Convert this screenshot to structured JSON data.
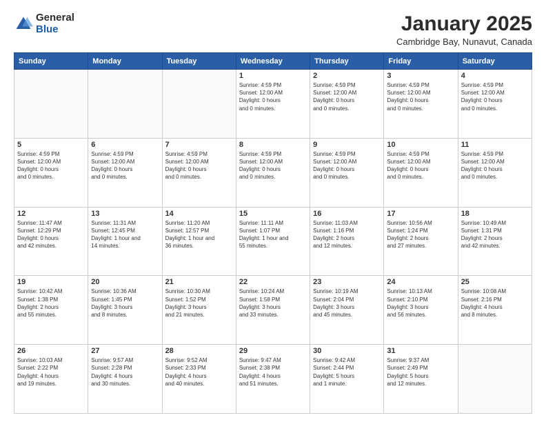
{
  "header": {
    "logo_general": "General",
    "logo_blue": "Blue",
    "main_title": "January 2025",
    "subtitle": "Cambridge Bay, Nunavut, Canada"
  },
  "weekdays": [
    "Sunday",
    "Monday",
    "Tuesday",
    "Wednesday",
    "Thursday",
    "Friday",
    "Saturday"
  ],
  "weeks": [
    [
      {
        "day": "",
        "info": ""
      },
      {
        "day": "",
        "info": ""
      },
      {
        "day": "",
        "info": ""
      },
      {
        "day": "1",
        "info": "Sunrise: 4:59 PM\nSunset: 12:00 AM\nDaylight: 0 hours\nand 0 minutes."
      },
      {
        "day": "2",
        "info": "Sunrise: 4:59 PM\nSunset: 12:00 AM\nDaylight: 0 hours\nand 0 minutes."
      },
      {
        "day": "3",
        "info": "Sunrise: 4:59 PM\nSunset: 12:00 AM\nDaylight: 0 hours\nand 0 minutes."
      },
      {
        "day": "4",
        "info": "Sunrise: 4:59 PM\nSunset: 12:00 AM\nDaylight: 0 hours\nand 0 minutes."
      }
    ],
    [
      {
        "day": "5",
        "info": "Sunrise: 4:59 PM\nSunset: 12:00 AM\nDaylight: 0 hours\nand 0 minutes."
      },
      {
        "day": "6",
        "info": "Sunrise: 4:59 PM\nSunset: 12:00 AM\nDaylight: 0 hours\nand 0 minutes."
      },
      {
        "day": "7",
        "info": "Sunrise: 4:59 PM\nSunset: 12:00 AM\nDaylight: 0 hours\nand 0 minutes."
      },
      {
        "day": "8",
        "info": "Sunrise: 4:59 PM\nSunset: 12:00 AM\nDaylight: 0 hours\nand 0 minutes."
      },
      {
        "day": "9",
        "info": "Sunrise: 4:59 PM\nSunset: 12:00 AM\nDaylight: 0 hours\nand 0 minutes."
      },
      {
        "day": "10",
        "info": "Sunrise: 4:59 PM\nSunset: 12:00 AM\nDaylight: 0 hours\nand 0 minutes."
      },
      {
        "day": "11",
        "info": "Sunrise: 4:59 PM\nSunset: 12:00 AM\nDaylight: 0 hours\nand 0 minutes."
      }
    ],
    [
      {
        "day": "12",
        "info": "Sunrise: 11:47 AM\nSunset: 12:29 PM\nDaylight: 0 hours\nand 42 minutes."
      },
      {
        "day": "13",
        "info": "Sunrise: 11:31 AM\nSunset: 12:45 PM\nDaylight: 1 hour and\n14 minutes."
      },
      {
        "day": "14",
        "info": "Sunrise: 11:20 AM\nSunset: 12:57 PM\nDaylight: 1 hour and\n36 minutes."
      },
      {
        "day": "15",
        "info": "Sunrise: 11:11 AM\nSunset: 1:07 PM\nDaylight: 1 hour and\n55 minutes."
      },
      {
        "day": "16",
        "info": "Sunrise: 11:03 AM\nSunset: 1:16 PM\nDaylight: 2 hours\nand 12 minutes."
      },
      {
        "day": "17",
        "info": "Sunrise: 10:56 AM\nSunset: 1:24 PM\nDaylight: 2 hours\nand 27 minutes."
      },
      {
        "day": "18",
        "info": "Sunrise: 10:49 AM\nSunset: 1:31 PM\nDaylight: 2 hours\nand 42 minutes."
      }
    ],
    [
      {
        "day": "19",
        "info": "Sunrise: 10:42 AM\nSunset: 1:38 PM\nDaylight: 2 hours\nand 55 minutes."
      },
      {
        "day": "20",
        "info": "Sunrise: 10:36 AM\nSunset: 1:45 PM\nDaylight: 3 hours\nand 8 minutes."
      },
      {
        "day": "21",
        "info": "Sunrise: 10:30 AM\nSunset: 1:52 PM\nDaylight: 3 hours\nand 21 minutes."
      },
      {
        "day": "22",
        "info": "Sunrise: 10:24 AM\nSunset: 1:58 PM\nDaylight: 3 hours\nand 33 minutes."
      },
      {
        "day": "23",
        "info": "Sunrise: 10:19 AM\nSunset: 2:04 PM\nDaylight: 3 hours\nand 45 minutes."
      },
      {
        "day": "24",
        "info": "Sunrise: 10:13 AM\nSunset: 2:10 PM\nDaylight: 3 hours\nand 56 minutes."
      },
      {
        "day": "25",
        "info": "Sunrise: 10:08 AM\nSunset: 2:16 PM\nDaylight: 4 hours\nand 8 minutes."
      }
    ],
    [
      {
        "day": "26",
        "info": "Sunrise: 10:03 AM\nSunset: 2:22 PM\nDaylight: 4 hours\nand 19 minutes."
      },
      {
        "day": "27",
        "info": "Sunrise: 9:57 AM\nSunset: 2:28 PM\nDaylight: 4 hours\nand 30 minutes."
      },
      {
        "day": "28",
        "info": "Sunrise: 9:52 AM\nSunset: 2:33 PM\nDaylight: 4 hours\nand 40 minutes."
      },
      {
        "day": "29",
        "info": "Sunrise: 9:47 AM\nSunset: 2:38 PM\nDaylight: 4 hours\nand 51 minutes."
      },
      {
        "day": "30",
        "info": "Sunrise: 9:42 AM\nSunset: 2:44 PM\nDaylight: 5 hours\nand 1 minute."
      },
      {
        "day": "31",
        "info": "Sunrise: 9:37 AM\nSunset: 2:49 PM\nDaylight: 5 hours\nand 12 minutes."
      },
      {
        "day": "",
        "info": ""
      }
    ]
  ]
}
